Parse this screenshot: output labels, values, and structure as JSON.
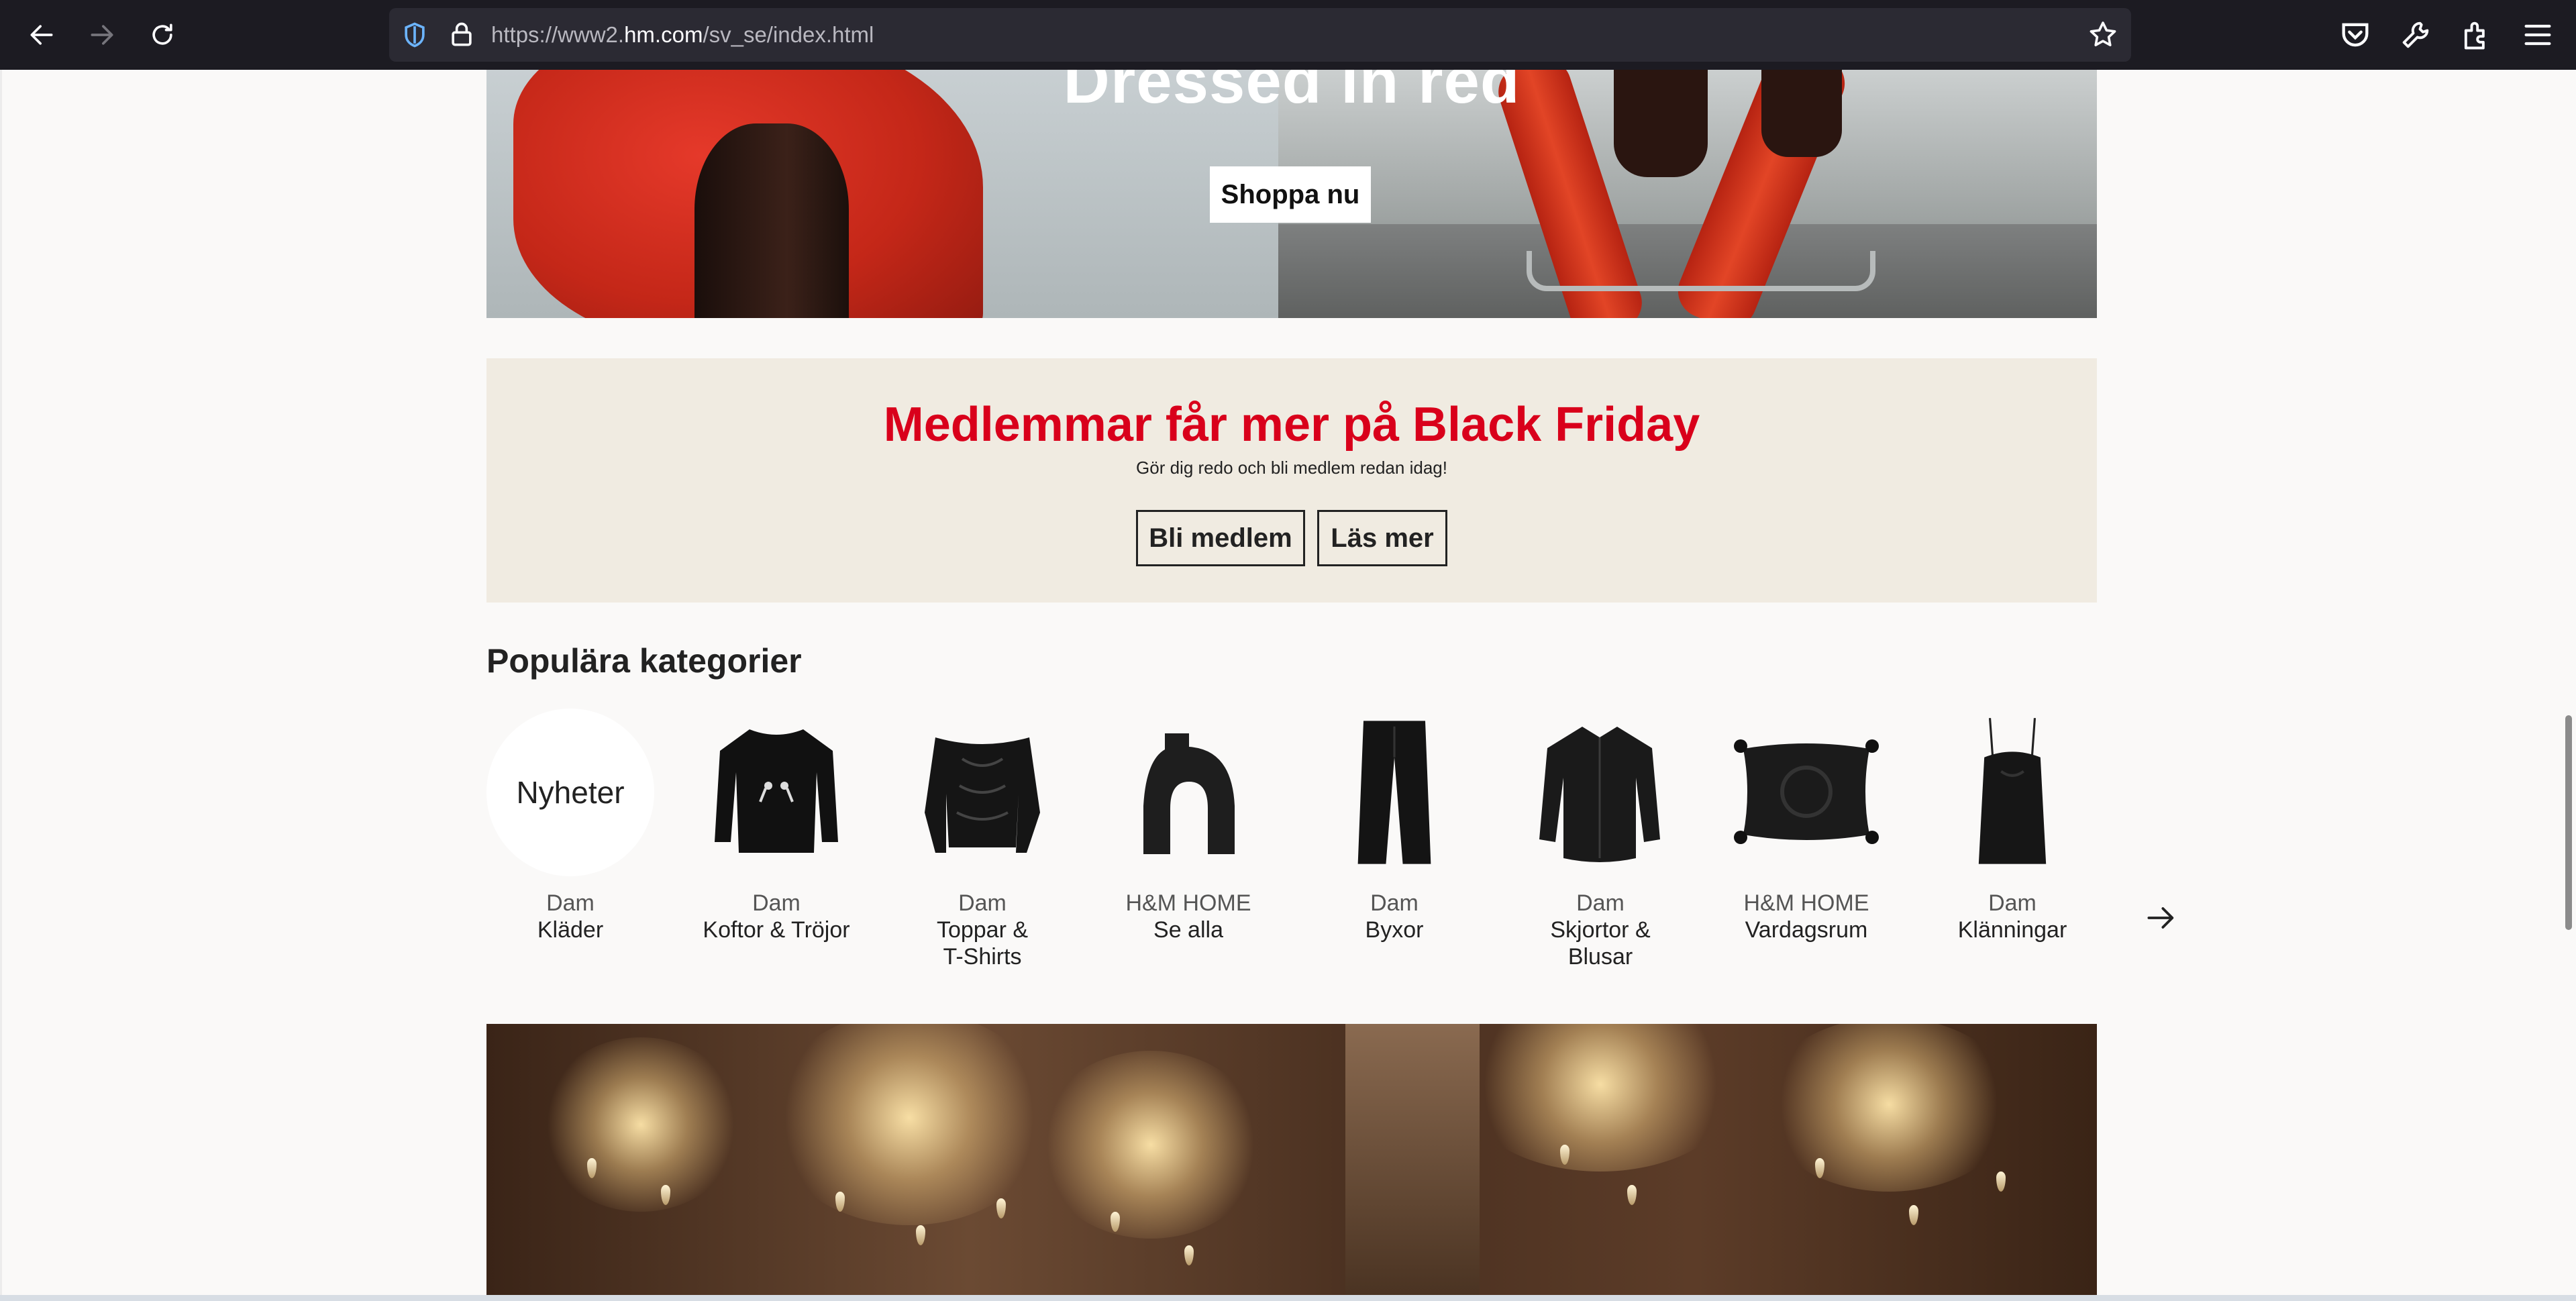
{
  "browser": {
    "url_prefix": "https://www2.",
    "url_domain": "hm.com",
    "url_path": "/sv_se/index.html",
    "icons": [
      "back-icon",
      "forward-icon",
      "reload-icon",
      "shield-icon",
      "lock-icon",
      "star-icon",
      "pocket-icon",
      "wrench-icon",
      "extensions-icon",
      "menu-icon"
    ]
  },
  "hero": {
    "title": "Dressed in red",
    "cta": "Shoppa nu"
  },
  "promo": {
    "title": "Medlemmar får mer på Black Friday",
    "subtitle": "Gör dig redo och bli medlem redan idag!",
    "btn_join": "Bli medlem",
    "btn_more": "Läs mer",
    "title_color": "#d9001b",
    "bg_color": "#f0ebe1"
  },
  "categories": {
    "heading": "Populära kategorier",
    "items": [
      {
        "label1": "Dam",
        "label2": "Kläder",
        "circle_text": "Nyheter"
      },
      {
        "label1": "Dam",
        "label2": "Koftor & Tröjor"
      },
      {
        "label1": "Dam",
        "label2": "Toppar &",
        "label3": "T-Shirts"
      },
      {
        "label1": "H&M HOME",
        "label2": "Se alla"
      },
      {
        "label1": "Dam",
        "label2": "Byxor"
      },
      {
        "label1": "Dam",
        "label2": "Skjortor &",
        "label3": "Blusar"
      },
      {
        "label1": "H&M HOME",
        "label2": "Vardagsrum"
      },
      {
        "label1": "Dam",
        "label2": "Klänningar"
      }
    ]
  }
}
